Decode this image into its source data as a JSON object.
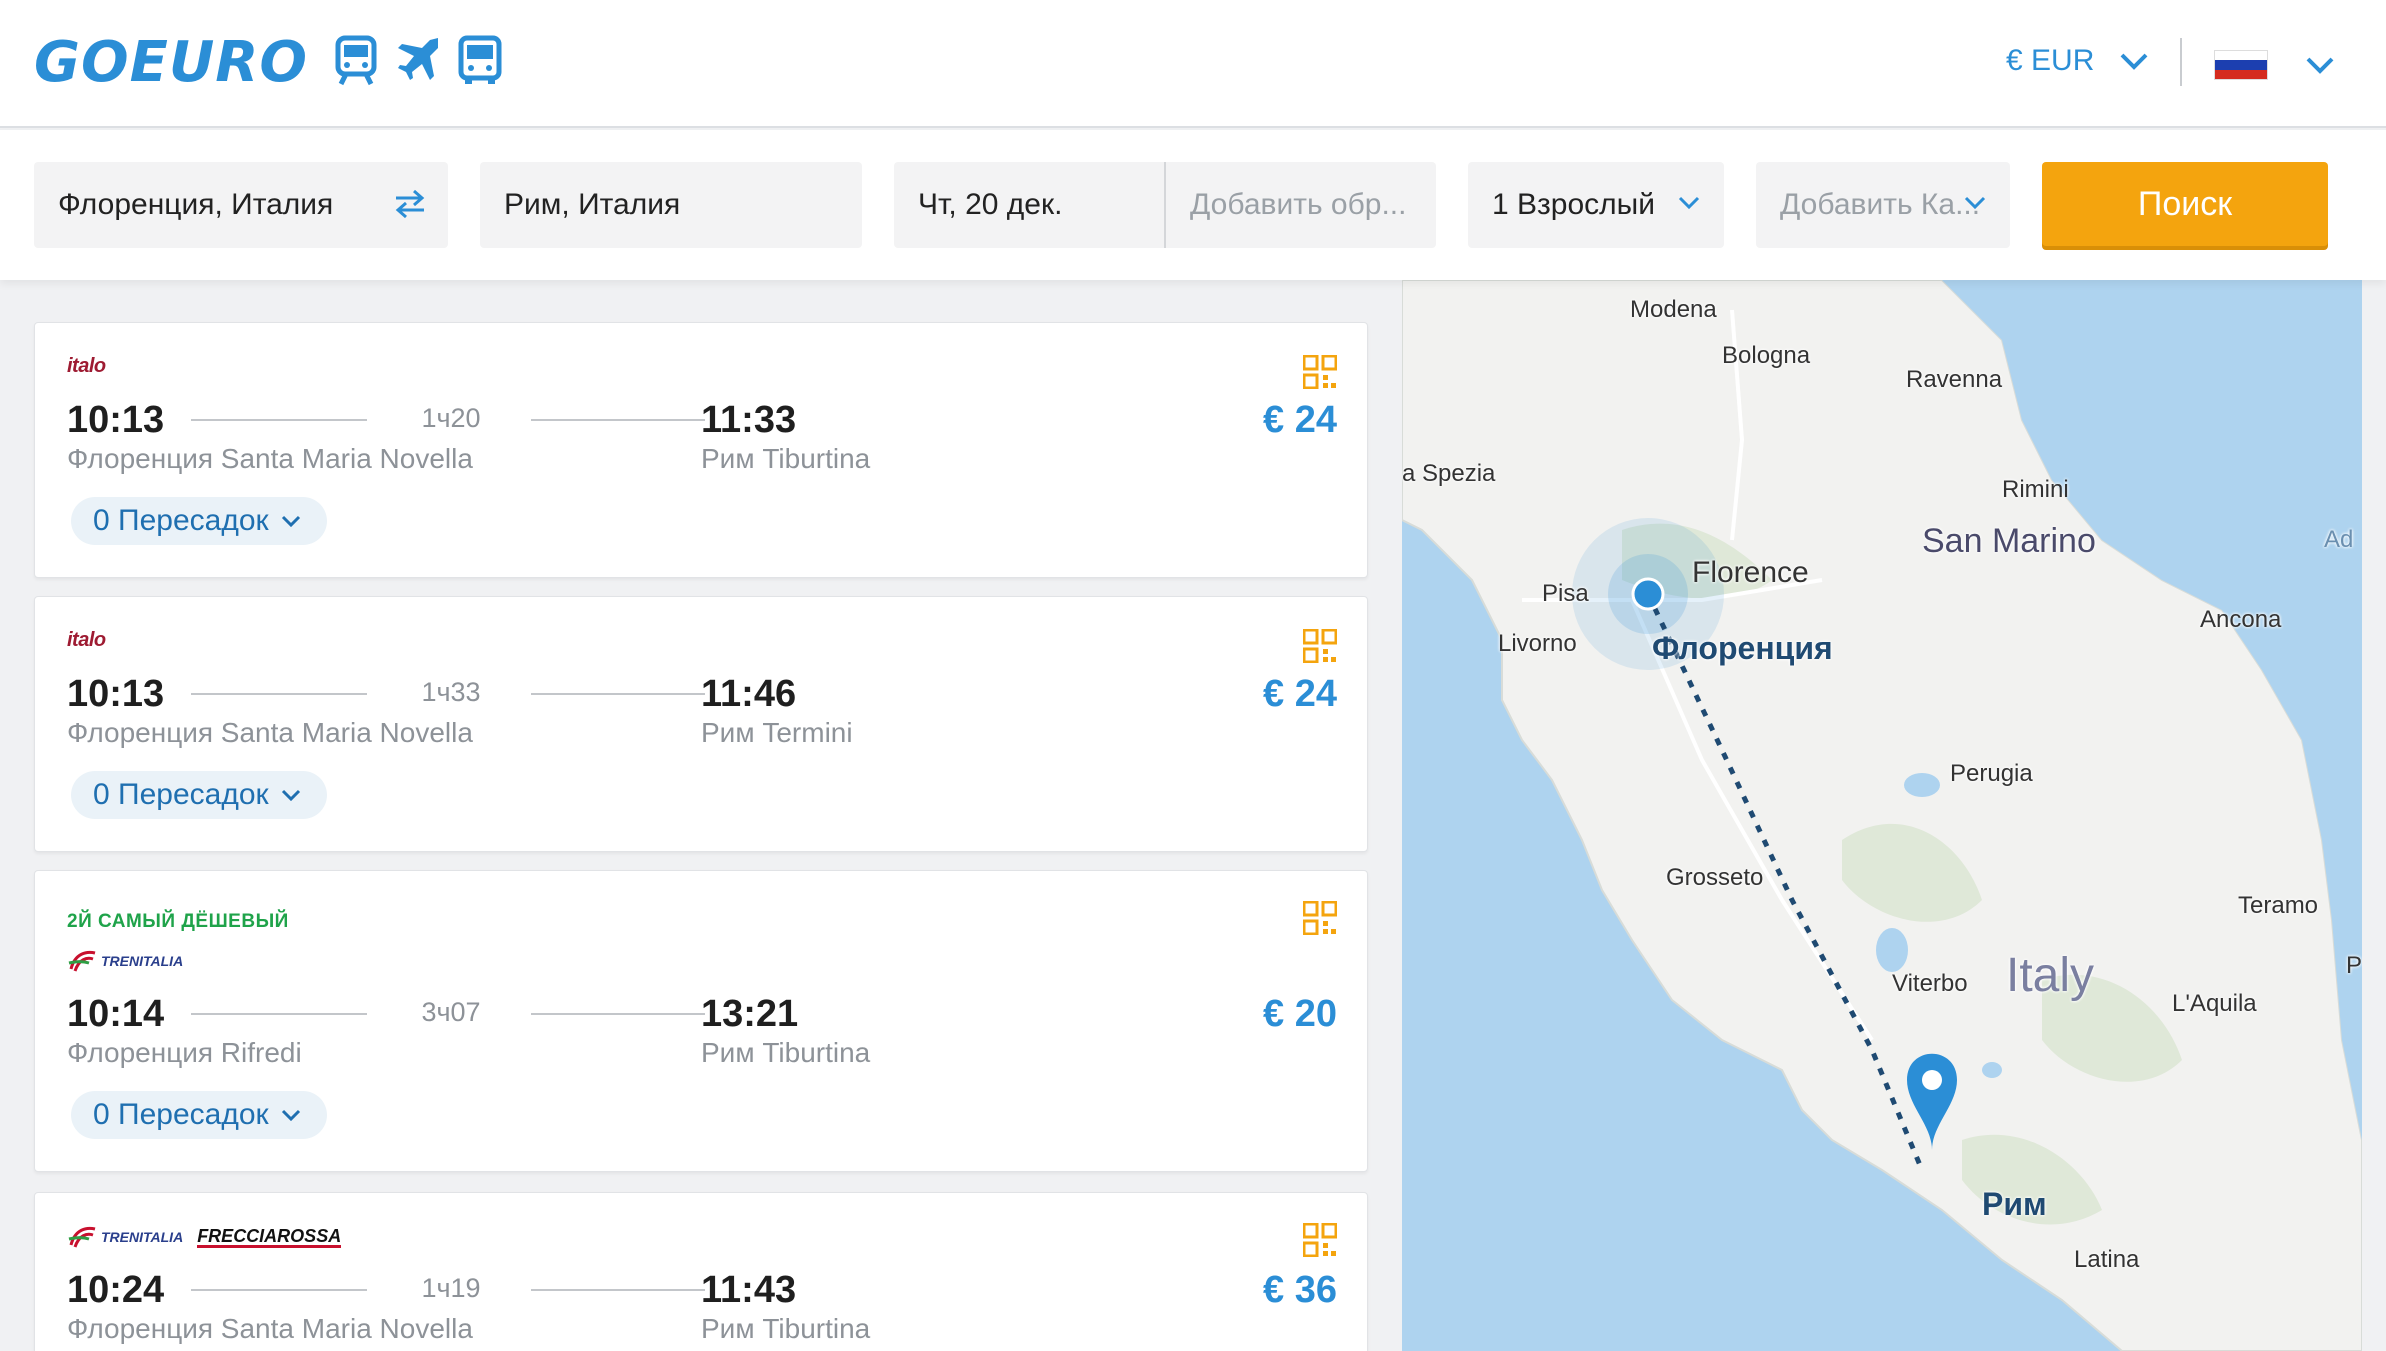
{
  "header": {
    "logo": "GOEURO",
    "mode_icons": [
      "train-icon",
      "plane-icon",
      "bus-icon"
    ],
    "currency": "€ EUR",
    "language_flag": "russia-flag-icon"
  },
  "search": {
    "origin": "Флоренция, Италия",
    "destination": "Рим, Италия",
    "departure_date": "Чт, 20 дек.",
    "return_placeholder": "Добавить обр...",
    "passengers": "1 Взрослый",
    "discount_placeholder": "Добавить Ка...",
    "search_button": "Поиск"
  },
  "results": [
    {
      "operator": "italo",
      "tag": "",
      "dep_time": "10:13",
      "duration": "1ч20",
      "arr_time": "11:33",
      "dep_station": "Флоренция Santa Maria Novella",
      "arr_station": "Рим Tiburtina",
      "price": "€ 24",
      "changes": "0 Пересадок"
    },
    {
      "operator": "italo",
      "tag": "",
      "dep_time": "10:13",
      "duration": "1ч33",
      "arr_time": "11:46",
      "dep_station": "Флоренция Santa Maria Novella",
      "arr_station": "Рим Termini",
      "price": "€ 24",
      "changes": "0 Пересадок"
    },
    {
      "operator": "TRENITALIA",
      "tag": "2Й САМЫЙ ДЁШЕВЫЙ",
      "dep_time": "10:14",
      "duration": "3ч07",
      "arr_time": "13:21",
      "dep_station": "Флоренция Rifredi",
      "arr_station": "Рим Tiburtina",
      "price": "€ 20",
      "changes": "0 Пересадок"
    },
    {
      "operator": "TRENITALIA",
      "operator2": "FRECCIAROSSA",
      "tag": "",
      "dep_time": "10:24",
      "duration": "1ч19",
      "arr_time": "11:43",
      "dep_station": "Флоренция Santa Maria Novella",
      "arr_station": "Рим Tiburtina",
      "price": "€ 36",
      "changes": ""
    }
  ],
  "map": {
    "labels": {
      "modena": "Modena",
      "bologna": "Bologna",
      "ravenna": "Ravenna",
      "spezia": "a Spezia",
      "rimini": "Rimini",
      "san_marino": "San Marino",
      "florence_en": "Florence",
      "florence_ru": "Флоренция",
      "pisa": "Pisa",
      "livorno": "Livorno",
      "ancona": "Ancona",
      "perugia": "Perugia",
      "grosseto": "Grosseto",
      "teramo": "Teramo",
      "italy": "Italy",
      "viterbo": "Viterbo",
      "laquila": "L'Aquila",
      "rome_ru": "Рим",
      "latina": "Latina",
      "edge_ad": "Ad",
      "edge_p": "P"
    }
  },
  "colors": {
    "brand": "#2b8ed6",
    "search_button": "#f4a40e",
    "cheap_tag": "#1fa34a",
    "route": "#1f4a72"
  }
}
